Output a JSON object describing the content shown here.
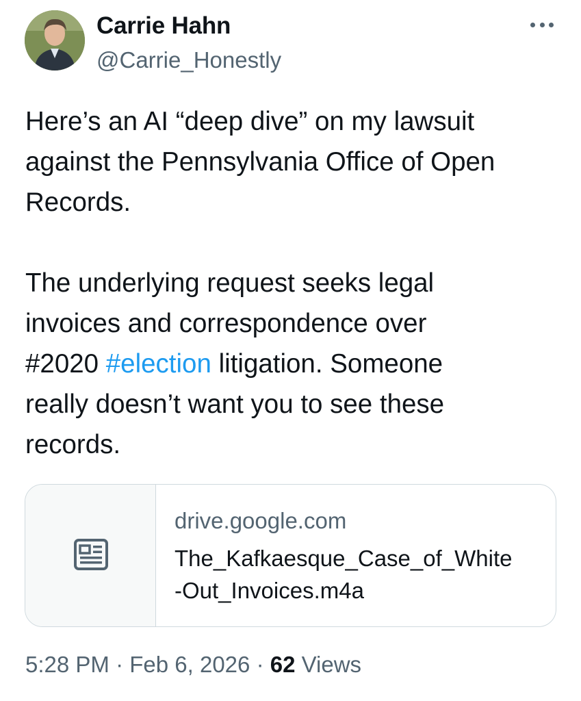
{
  "author": {
    "display_name": "Carrie Hahn",
    "handle": "@Carrie_Honestly",
    "avatar_icon": "profile-photo"
  },
  "menu_icon": "more-horizontal-icon",
  "tweet": {
    "lines_p1": [
      "Here’s an AI “deep dive” on my lawsuit",
      "against the Pennsylvania Office of Open",
      "Records."
    ],
    "lines_p2_pre": [
      "The underlying request seeks legal",
      "invoices and correspondence over"
    ],
    "line_hashtags": {
      "hashtag_plain": "#2020",
      "hashtag_link": "#election",
      "after": "litigation. Someone"
    },
    "lines_p2_post": [
      "really doesn’t want you to see these",
      "records."
    ]
  },
  "card": {
    "icon": "article-icon",
    "domain": "drive.google.com",
    "title_line1": "The_Kafkaesque_Case_of_White",
    "title_line2": "-Out_Invoices.m4a"
  },
  "meta": {
    "time": "5:28 PM",
    "separator": "·",
    "date": "Feb 6, 2026",
    "views_count": "62",
    "views_label": "Views"
  },
  "colors": {
    "text_primary": "#0f1419",
    "text_secondary": "#536471",
    "link": "#1d9bf0",
    "border": "#cfd9de",
    "card_thumb_bg": "#f7f9f9"
  }
}
